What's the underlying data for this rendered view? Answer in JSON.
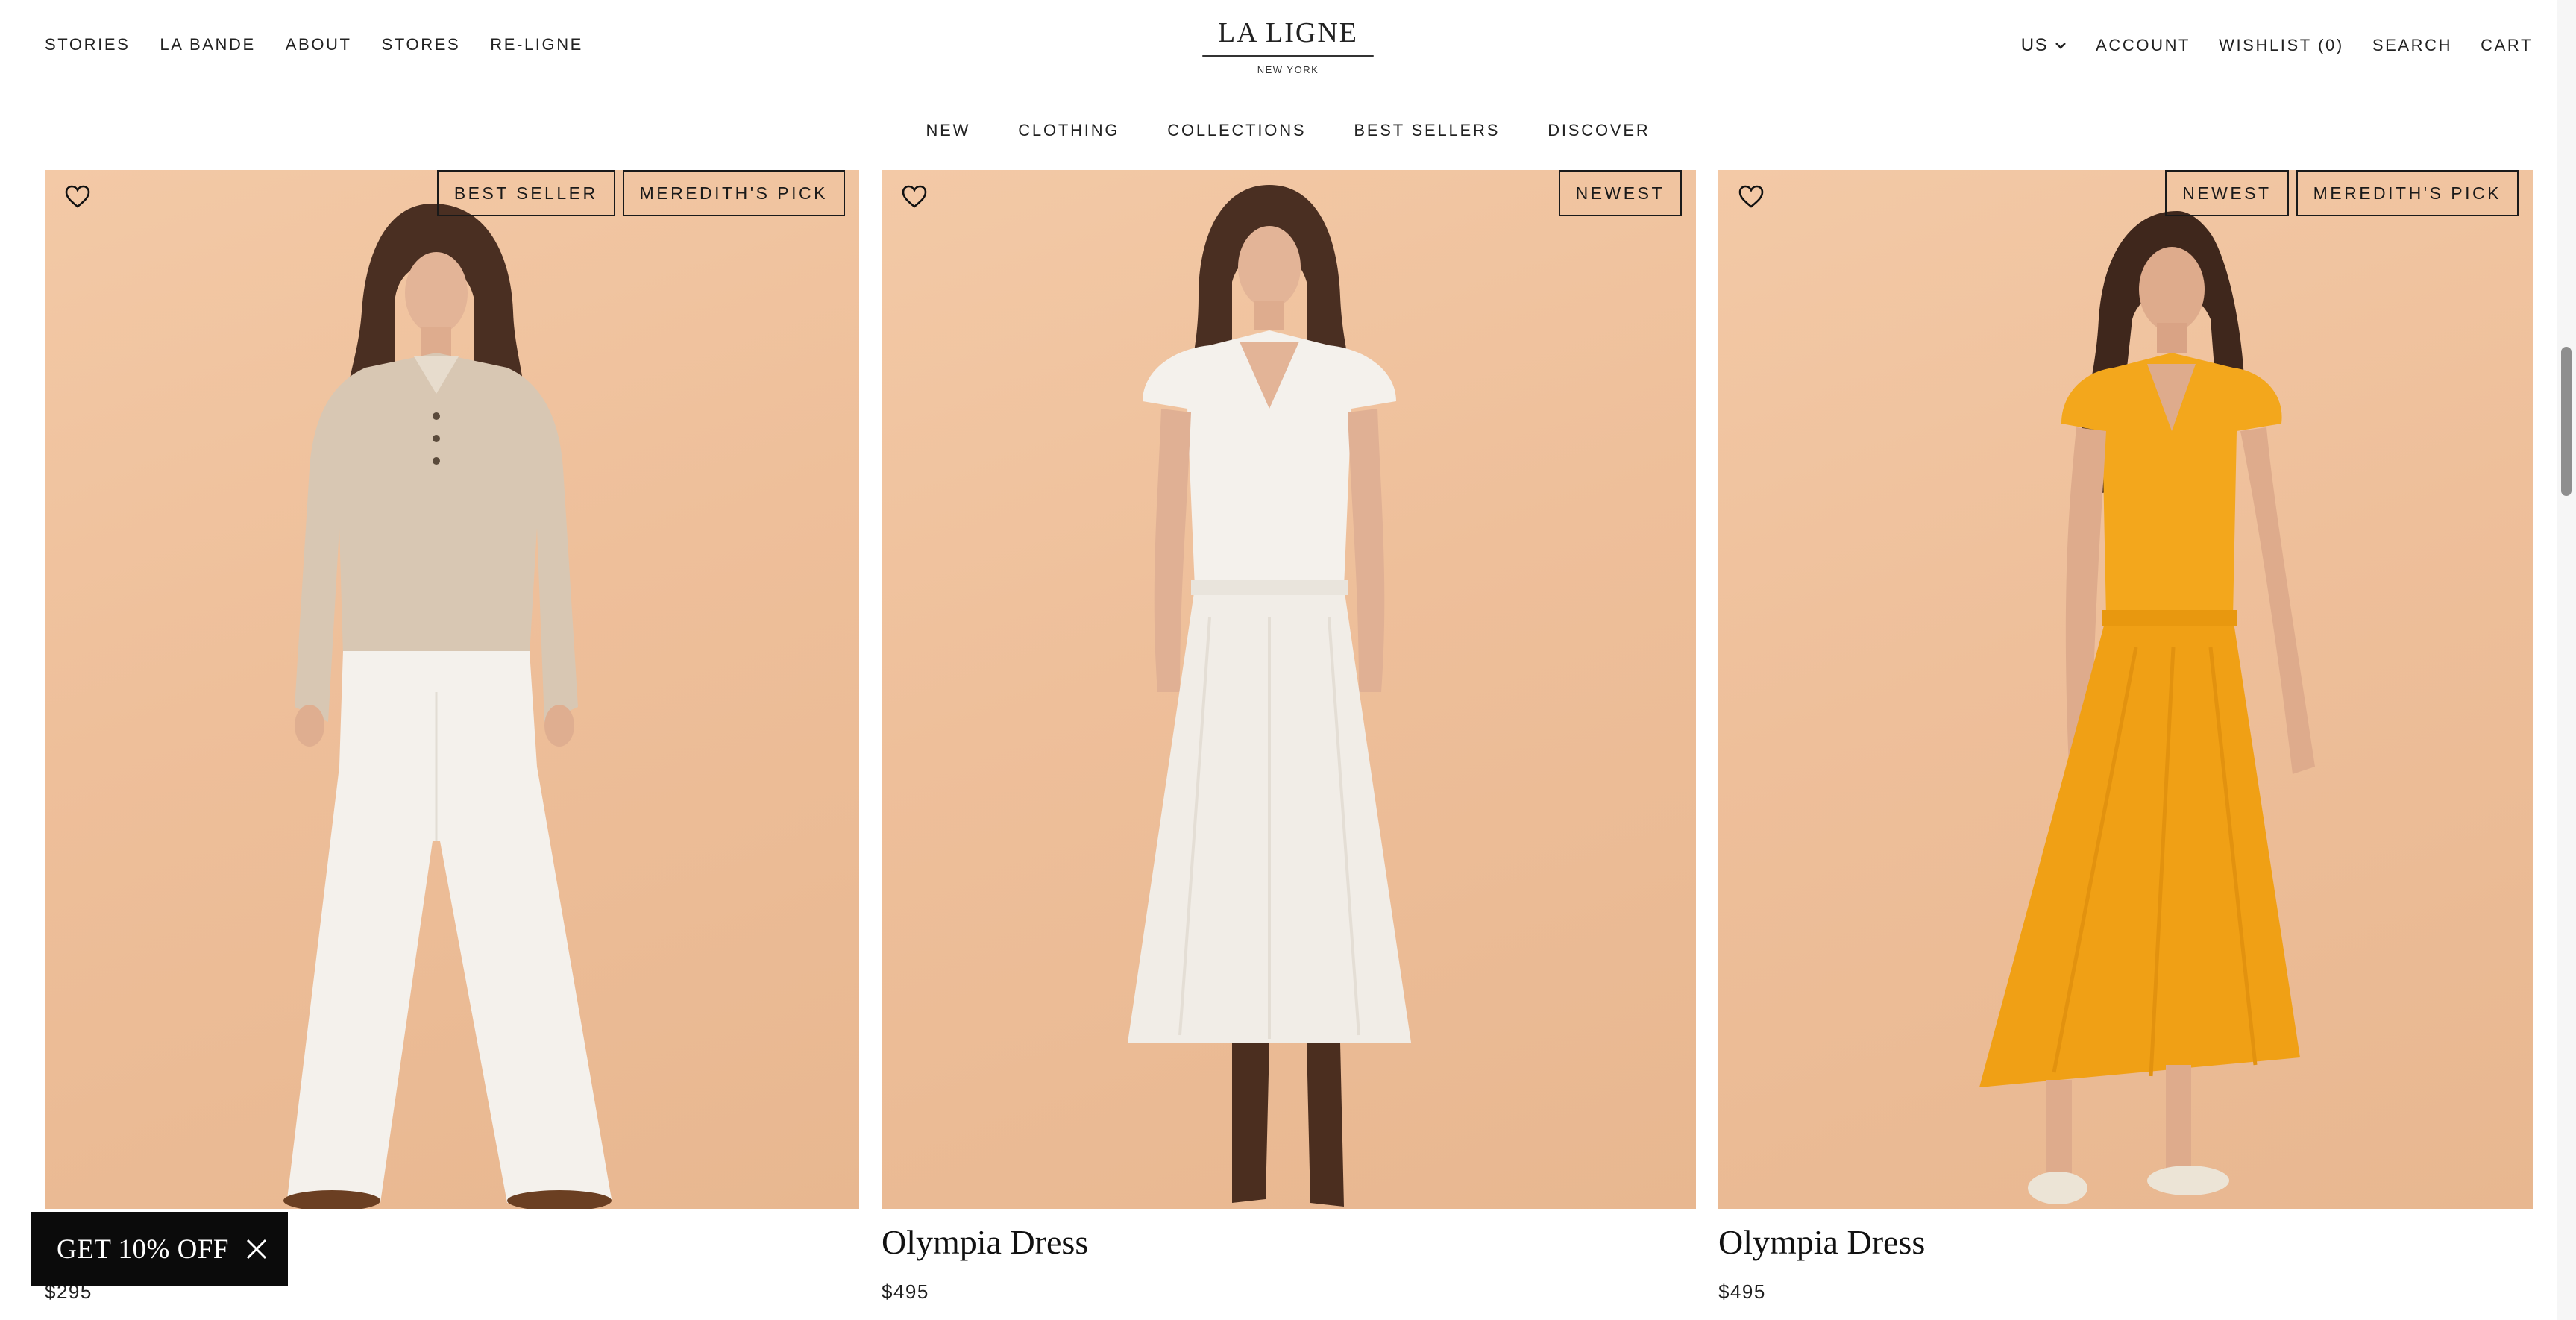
{
  "header": {
    "nav_left": [
      "STORIES",
      "LA BANDE",
      "ABOUT",
      "STORES",
      "RE-LIGNE"
    ],
    "logo_main": "LA LIGNE",
    "logo_sub": "NEW YORK",
    "country": "US",
    "nav_right": [
      "ACCOUNT",
      "WISHLIST (0)",
      "SEARCH",
      "CART"
    ]
  },
  "subnav": [
    "NEW",
    "CLOTHING",
    "COLLECTIONS",
    "BEST SELLERS",
    "DISCOVER"
  ],
  "products": [
    {
      "name": "",
      "price": "$295",
      "badges": [
        "BEST SELLER",
        "MEREDITH'S PICK"
      ]
    },
    {
      "name": "Olympia Dress",
      "price": "$495",
      "badges": [
        "NEWEST"
      ]
    },
    {
      "name": "Olympia Dress",
      "price": "$495",
      "badges": [
        "NEWEST",
        "MEREDITH'S PICK"
      ]
    }
  ],
  "promo": {
    "label": "GET 10% OFF"
  },
  "colors": {
    "backdrop": "#eebf9a",
    "dress_white": "#f4f1ec",
    "dress_yellow": "#f3a71c",
    "promo_bg": "#0b0b0b"
  }
}
